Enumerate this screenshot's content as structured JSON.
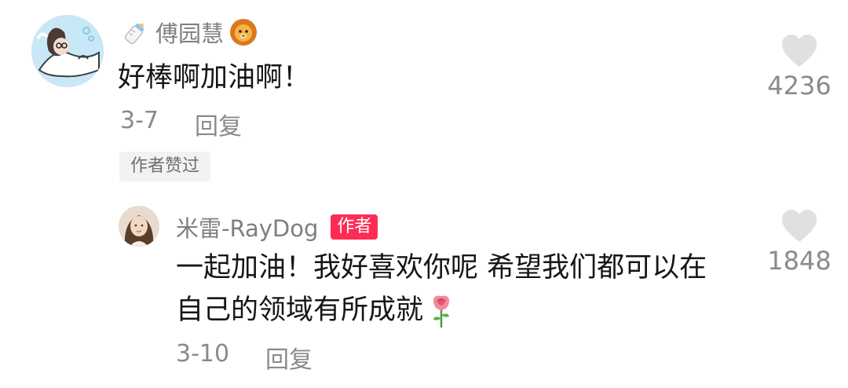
{
  "comments": [
    {
      "username": "傅园慧",
      "text": "好棒啊加油啊！",
      "date": "3-7",
      "reply_label": "回复",
      "likes": "4236",
      "author_liked_label": "作者赞过",
      "leading_icon": "baby-bottle-icon",
      "trailing_icon": "lion-face-icon"
    },
    {
      "username": "米雷-RayDog",
      "author_badge": "作者",
      "text_line_1": "一起加油！我好喜欢你呢 希望我们都可以在",
      "text_line_2": "自己的领域有所成就",
      "trailing_icon": "rose-icon",
      "date": "3-10",
      "reply_label": "回复",
      "likes": "1848"
    }
  ],
  "colors": {
    "author_badge_bg": "#fd2c55",
    "username": "#7f7f7f",
    "comment_text": "#161616",
    "meta_text": "#8a8a8a",
    "heart": "#e0e0e0",
    "chip_bg": "#f2f2f2"
  }
}
